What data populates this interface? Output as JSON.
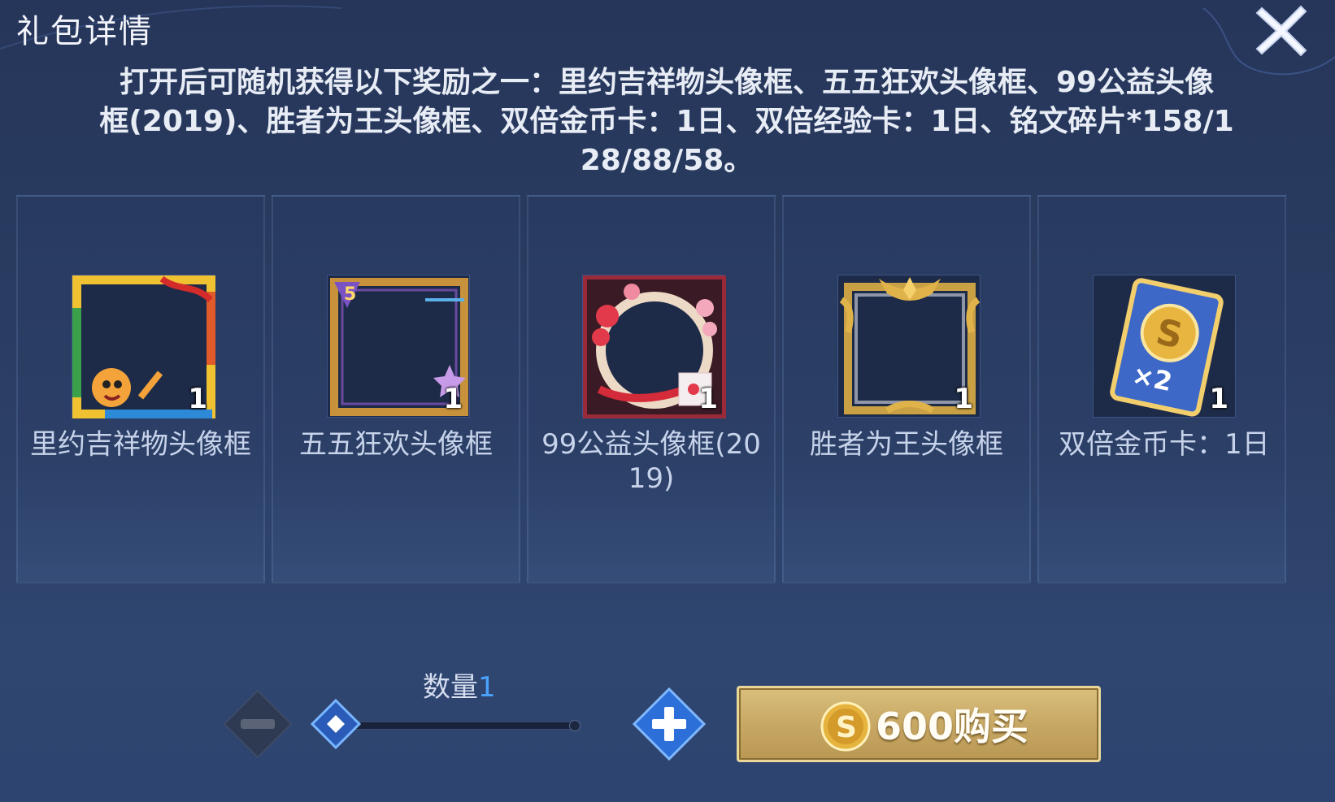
{
  "header": {
    "title": "礼包详情"
  },
  "description": {
    "line1": "打开后可随机获得以下奖励之一：里约吉祥物头像框、五五狂欢头像框、99公益头像",
    "line2": "框(2019)、胜者为王头像框、双倍金币卡：1日、双倍经验卡：1日、铭文碎片*158/1",
    "line3": "28/88/58。"
  },
  "rewards": [
    {
      "name": "里约吉祥物头像框",
      "count": "1",
      "icon": "mascot-frame-icon"
    },
    {
      "name": "五五狂欢头像框",
      "count": "1",
      "icon": "star-frame-icon"
    },
    {
      "name": "99公益头像框(20\n19)",
      "count": "1",
      "icon": "flower-frame-icon"
    },
    {
      "name": "胜者为王头像框",
      "count": "1",
      "icon": "gold-frame-icon"
    },
    {
      "name": "双倍金币卡：1日",
      "count": "1",
      "icon": "double-coin-card-icon"
    }
  ],
  "quantity": {
    "label": "数量",
    "value": "1"
  },
  "buy": {
    "price": "600",
    "label": "600购买"
  },
  "colors": {
    "background": "#2b3d63",
    "accent_blue": "#4aa3ff",
    "buy_gold": "#c8a865"
  }
}
